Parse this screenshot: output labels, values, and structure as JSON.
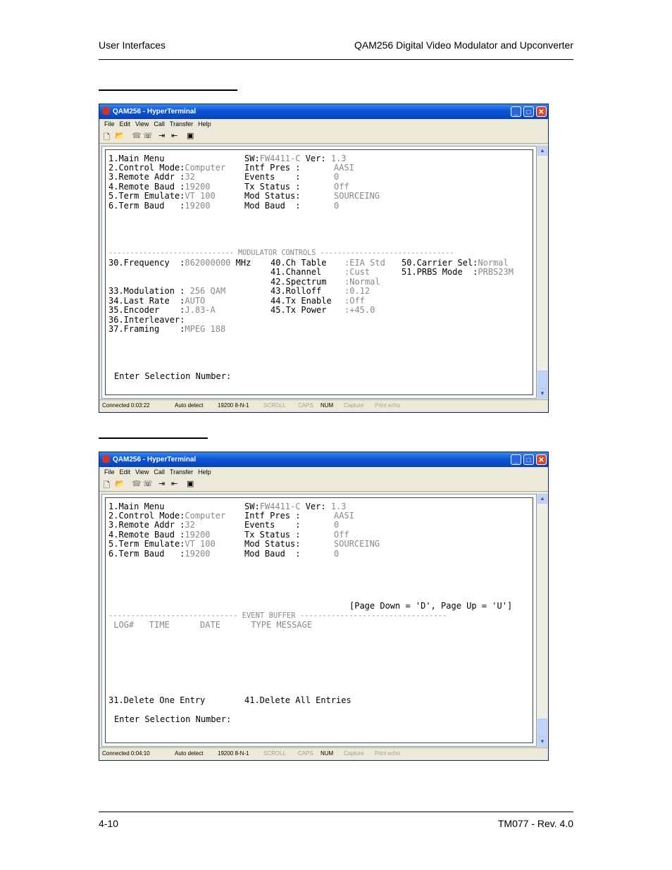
{
  "header": {
    "left": "User Interfaces",
    "right": "QAM256 Digital Video Modulator and Upconverter"
  },
  "footer": {
    "left": "4-10",
    "right": "TM077 - Rev. 4.0"
  },
  "window_common": {
    "title": "QAM256 - HyperTerminal",
    "menu": [
      "File",
      "Edit",
      "View",
      "Call",
      "Transfer",
      "Help"
    ],
    "status_items": [
      "Auto detect",
      "19200 8-N-1",
      "SCROLL",
      "CAPS",
      "NUM",
      "Capture",
      "Print echo"
    ]
  },
  "window1": {
    "connected": "Connected 0:03:22",
    "lines": {
      "l1a": "1.Main Menu",
      "l1b": "SW:",
      "l1c": "FW4411-C",
      "l1d": " Ver: ",
      "l1e": "1.3",
      "l2a": "2.Control Mode:",
      "l2b": "Computer",
      "l2c": "Intf Pres :",
      "l2d": "AASI",
      "l3a": "3.Remote Addr :",
      "l3b": "32",
      "l3c": "Events    :",
      "l3d": "0",
      "l4a": "4.Remote Baud :",
      "l4b": "19200",
      "l4c": "Tx Status :",
      "l4d": "Off",
      "l5a": "5.Term Emulate:",
      "l5b": "VT 100",
      "l5c": "Mod Status:",
      "l5d": "SOURCEING",
      "l6a": "6.Term Baud   :",
      "l6b": "19200",
      "l6c": "Mod Baud  :",
      "l6d": "0",
      "divider": "----------------------------- MODULATOR CONTROLS -------------------------------",
      "f30a": "30.Frequency  :",
      "f30b": "862000000",
      "f30c": " MHz",
      "f40a": "40.Ch Table",
      "f40b": ":EIA Std",
      "f41a": "41.Channel",
      "f41b": ":Cust",
      "f42a": "42.Spectrum",
      "f42b": ":Normal",
      "f43a": "43.Rolloff",
      "f43b": ":0.12",
      "f44a": "44.Tx Enable",
      "f44b": ":Off",
      "f45a": "45.Tx Power",
      "f45b": ":+45.0",
      "f50a": "50.Carrier Sel:",
      "f50b": "Normal",
      "f51a": "51.PRBS Mode  :",
      "f51b": "PRBS23M",
      "f33a": "33.Modulation :",
      "f33b": " 256 QAM",
      "f34a": "34.Last Rate  :",
      "f34b": "AUTO",
      "f35a": "35.Encoder    :",
      "f35b": "J.83-A",
      "f36a": "36.Interleaver:",
      "f37a": "37.Framing    :",
      "f37b": "MPEG 188",
      "prompt": "Enter Selection Number:"
    }
  },
  "window2": {
    "connected": "Connected 0:04:10",
    "lines": {
      "l1a": "1.Main Menu",
      "l1b": "SW:",
      "l1c": "FW4411-C",
      "l1d": " Ver: ",
      "l1e": "1.3",
      "l2a": "2.Control Mode:",
      "l2b": "Computer",
      "l2c": "Intf Pres :",
      "l2d": "AASI",
      "l3a": "3.Remote Addr :",
      "l3b": "32",
      "l3c": "Events    :",
      "l3d": "0",
      "l4a": "4.Remote Baud :",
      "l4b": "19200",
      "l4c": "Tx Status :",
      "l4d": "Off",
      "l5a": "5.Term Emulate:",
      "l5b": "VT 100",
      "l5c": "Mod Status:",
      "l5d": "SOURCEING",
      "l6a": "6.Term Baud   :",
      "l6b": "19200",
      "l6c": "Mod Baud  :",
      "l6d": "0",
      "paging": "[Page Down = 'D', Page Up = 'U']",
      "divider": "----------------------------- EVENT BUFFER ---------------------------------",
      "cols": " LOG#   TIME      DATE      TYPE MESSAGE",
      "del1": "31.Delete One Entry",
      "del2": "41.Delete All Entries",
      "prompt": "Enter Selection Number:"
    }
  }
}
